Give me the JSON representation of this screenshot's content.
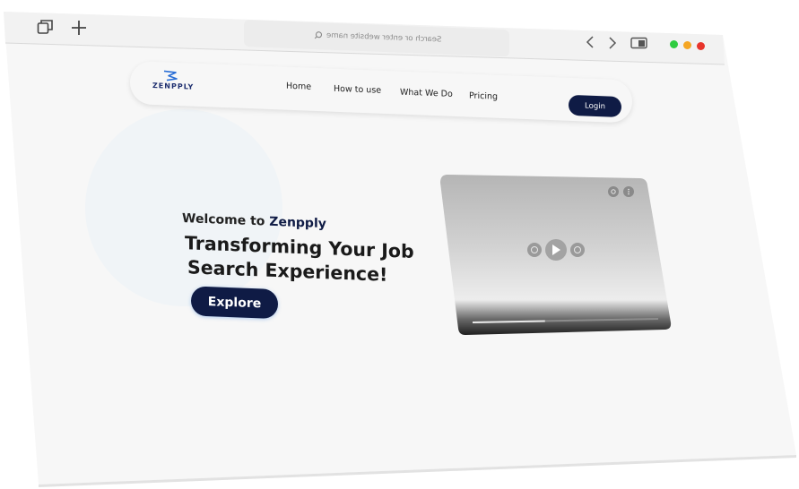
{
  "browser": {
    "toolbar_icons": [
      "tabs-icon",
      "new-tab-plus-icon"
    ],
    "address_placeholder": "Search or enter website name",
    "back_icon": "chevron-left-icon",
    "forward_icon": "chevron-right-icon",
    "sidebar_icon": "sidebar-toggle-icon",
    "window_controls": [
      {
        "name": "minimize",
        "color": "#2ecc40"
      },
      {
        "name": "zoom",
        "color": "#f5a623"
      },
      {
        "name": "close",
        "color": "#e8352c"
      }
    ]
  },
  "nav": {
    "logo_text": "ZENPPLY",
    "links": [
      "Home",
      "How to use",
      "What We Do",
      "Pricing"
    ],
    "login_label": "Login"
  },
  "hero": {
    "welcome_prefix": "Welcome to ",
    "welcome_brand": "Zenpply",
    "headline_line1": "Transforming Your Job",
    "headline_line2": "Search Experience!",
    "cta_label": "Explore"
  },
  "video": {
    "icons": [
      "settings-icon",
      "more-icon",
      "rewind-icon",
      "play-icon",
      "forward-icon"
    ],
    "progress": 0.39
  },
  "colors": {
    "brand_navy": "#0f1b45",
    "page_bg": "#f7f7f7"
  }
}
